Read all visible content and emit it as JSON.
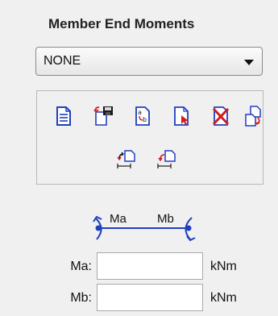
{
  "panel": {
    "title": "Member End Moments"
  },
  "dropdown": {
    "selected": "NONE"
  },
  "toolbar": {
    "icons": [
      "new-document-icon",
      "import-save-icon",
      "swap-ab-icon",
      "pick-icon",
      "delete-icon",
      "copy-icon",
      "flip-icon",
      "apply-icon"
    ]
  },
  "diagram": {
    "label_a": "Ma",
    "label_b": "Mb"
  },
  "fields": {
    "ma_label": "Ma:",
    "ma_value": "",
    "ma_unit": "kNm",
    "mb_label": "Mb:",
    "mb_value": "",
    "mb_unit": "kNm"
  },
  "colors": {
    "accent_blue": "#1f3fbf",
    "accent_red": "#d01c1c"
  }
}
